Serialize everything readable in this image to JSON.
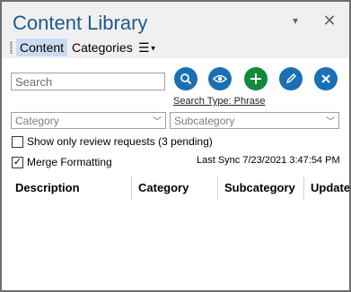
{
  "title": "Content Library",
  "title_buttons": {
    "dropdown": "▾",
    "close": "✕"
  },
  "tabs": [
    {
      "label": "Content",
      "active": true
    },
    {
      "label": "Categories",
      "active": false
    }
  ],
  "menu_button": {
    "icon": "hamburger-menu-icon",
    "label": "☰"
  },
  "search": {
    "placeholder": "Search",
    "value": ""
  },
  "actions": [
    {
      "name": "search",
      "icon": "magnifier-icon",
      "color": "#1b6fb5"
    },
    {
      "name": "preview",
      "icon": "eye-icon",
      "color": "#1b6fb5"
    },
    {
      "name": "add",
      "icon": "plus-icon",
      "color": "#118a3d"
    },
    {
      "name": "edit",
      "icon": "pencil-icon",
      "color": "#1b6fb5"
    },
    {
      "name": "delete",
      "icon": "x-icon",
      "color": "#1b6fb5"
    }
  ],
  "search_type": "Search Type: Phrase",
  "filters": {
    "category_placeholder": "Category",
    "subcategory_placeholder": "Subcategory"
  },
  "options": {
    "review_requests": {
      "label": "Show only review requests (3 pending)",
      "checked": false
    },
    "merge_formatting": {
      "label": "Merge Formatting",
      "checked": true
    }
  },
  "last_sync": "Last Sync 7/23/2021 3:47:54 PM",
  "columns": [
    "Description",
    "Category",
    "Subcategory",
    "Update"
  ],
  "colors": {
    "accent": "#1e5a8c",
    "active_tab": "#c9dcf0",
    "green": "#118a3d"
  }
}
